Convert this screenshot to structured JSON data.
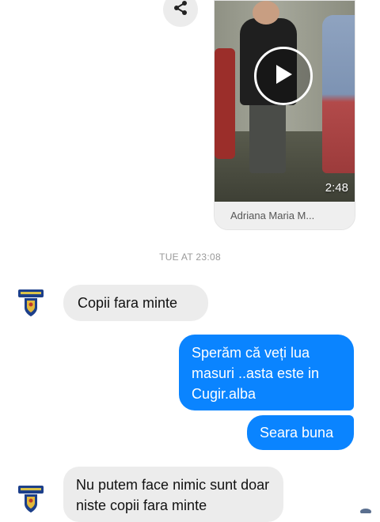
{
  "share": {
    "icon": "share-icon"
  },
  "video": {
    "duration": "2:48",
    "sender_name": "Adriana Maria M...",
    "play_icon": "play-icon"
  },
  "timestamp": "TUE AT 23:08",
  "messages": [
    {
      "direction": "incoming",
      "text": "Copii fara minte"
    },
    {
      "direction": "outgoing",
      "text": "Sperăm că veți lua masuri ..asta este in Cugir.alba"
    },
    {
      "direction": "outgoing",
      "text": "Seara buna"
    },
    {
      "direction": "incoming",
      "text": "Nu putem face nimic sunt doar niste copii fara minte"
    }
  ],
  "colors": {
    "outgoing_bubble": "#0a84ff",
    "incoming_bubble": "#ececec",
    "timestamp_text": "#9a9a9a"
  },
  "avatar": {
    "icon": "police-badge-avatar-icon"
  }
}
